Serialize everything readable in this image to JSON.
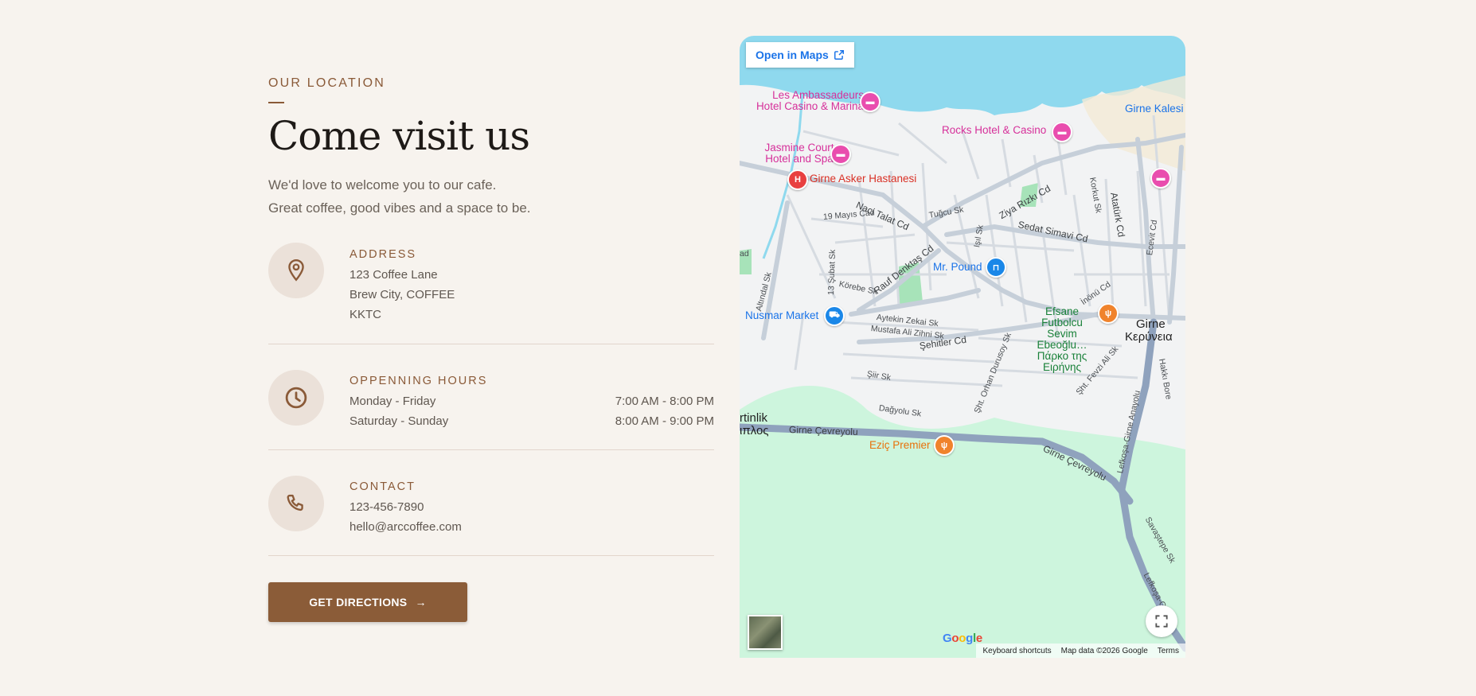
{
  "section": {
    "eyebrow": "OUR LOCATION",
    "title": "Come visit us",
    "intro_line1": "We'd love to welcome you to our cafe.",
    "intro_line2": "Great coffee, good vibes and a space to be."
  },
  "address": {
    "label": "ADDRESS",
    "lines": [
      "123 Coffee Lane",
      "Brew City, COFFEE",
      "KKTC"
    ],
    "icon": "location-pin-icon"
  },
  "hours": {
    "label": "OPPENNING HOURS",
    "rows": [
      {
        "days": "Monday - Friday",
        "time": "7:00 AM - 8:00 PM"
      },
      {
        "days": "Saturday - Sunday",
        "time": "8:00 AM - 9:00 PM"
      }
    ],
    "icon": "clock-icon"
  },
  "contact": {
    "label": "CONTACT",
    "phone": "123-456-7890",
    "email": "hello@arccoffee.com",
    "icon": "phone-icon"
  },
  "cta": {
    "label": "GET DIRECTIONS",
    "arrow": "→"
  },
  "map": {
    "open_label": "Open in Maps",
    "pois": {
      "ambassadeurs_1": "Les Ambassadeurs",
      "ambassadeurs_2": "Hotel Casino & Marina",
      "rocks": "Rocks Hotel & Casino",
      "girne_kalesi": "Girne Kalesi",
      "jasmine_1": "Jasmine Court",
      "jasmine_2": "Hotel and Spa",
      "hospital": "Girne Asker Hastanesi",
      "mr_pound": "Mr. Pound",
      "nusmar": "Nusmar Market",
      "efsane_1": "Efsane",
      "efsane_2": "Futbolcu",
      "efsane_3": "Sevim",
      "efsane_4": "Ebeoğlu…",
      "efsane_5": "Πάρκο της",
      "efsane_6": "Ειρήνης",
      "eziz": "Eziç Premier"
    },
    "streets": {
      "naci": "Naci Talat Cd",
      "ziya": "Ziya Rızkı Cd",
      "sedat": "Sedat Simavi Cd",
      "ataturk": "Atatürk Cd",
      "ecevit": "Ecevit Cd",
      "korkut": "Korkut Sk",
      "mayis": "19 Mayıs Cad",
      "tugcu": "Tuğcu Sk",
      "rauf": "Rauf Denktaş Cd",
      "isil": "Işıl Sk",
      "inonu": "İnönü Cd",
      "subat": "13 Şubat Sk",
      "korebe": "Körebe Sk",
      "altindal": "Altındal Sk",
      "aytekin": "Aytekin Zekai Sk",
      "mustafa": "Mustafa Ali Zihni Sk",
      "sehitler": "Şehitler Cd",
      "orhan": "Şht. Orhan Durusoy Sk",
      "fevzi": "Şht. Fevzi Ali Sk",
      "hakki": "Hakkı Bore",
      "siir": "Şiir Sk",
      "dagyolu": "Dağyolu Sk",
      "cevreyolu1": "Girne Çevreyolu",
      "cevreyolu2": "Girne Çevreyolu",
      "lefkosa1": "Lefkoşa-Girne Anayolu",
      "lefkosa2": "Lefkoşa-Girne",
      "savastepe": "Savaştepe Sk",
      "ad": "ad"
    },
    "places": {
      "girne": "Girne",
      "kerynia": "Κερύνεια",
      "ertinlik": "rtinlik",
      "ptlos": "ιπλος"
    },
    "footer": {
      "logo": "Google",
      "shortcuts": "Keyboard shortcuts",
      "mapdata": "Map data ©2026 Google",
      "terms": "Terms"
    },
    "colors": {
      "water": "#8fd9ee",
      "park": "#cdf5dd",
      "road": "#c6cfd9",
      "highway": "#8fa2bd"
    }
  }
}
